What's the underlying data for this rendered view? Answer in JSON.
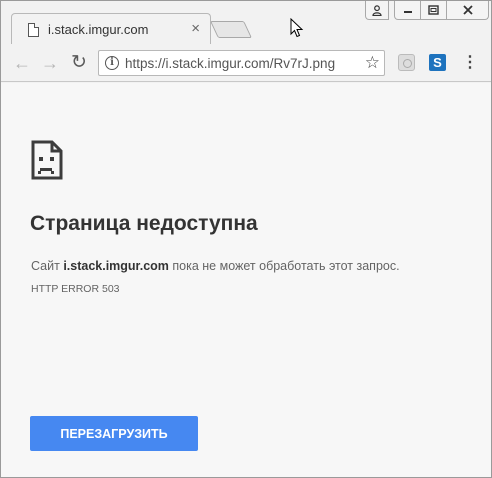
{
  "tab": {
    "title": "i.stack.imgur.com",
    "close_glyph": "×"
  },
  "window_controls": {
    "user_glyph": "👤",
    "minimize_glyph": "—",
    "maximize_glyph": "▢",
    "close_glyph": "✕"
  },
  "toolbar": {
    "back_glyph": "←",
    "forward_glyph": "→",
    "reload_glyph": "↻",
    "url": "https://i.stack.imgur.com/Rv7rJ.png",
    "star_glyph": "☆",
    "extension_s_label": "S",
    "menu_glyph": "⋮"
  },
  "error": {
    "title": "Страница недоступна",
    "desc_prefix": "Сайт ",
    "host": "i.stack.imgur.com",
    "desc_suffix": " пока не может обработать этот запрос.",
    "code": "HTTP ERROR 503",
    "reload_label": "ПЕРЕЗАГРУЗИТЬ"
  },
  "colors": {
    "accent": "#4688f1",
    "page_bg": "#f7f7f7",
    "text_dark": "#333333",
    "text_muted": "#646464"
  },
  "icons": [
    "page-favicon-icon",
    "back-arrow-icon",
    "forward-arrow-icon",
    "reload-icon",
    "info-icon",
    "star-icon",
    "extension-icon",
    "skype-extension-icon",
    "menu-dots-icon",
    "sad-page-icon",
    "mouse-cursor-icon"
  ]
}
